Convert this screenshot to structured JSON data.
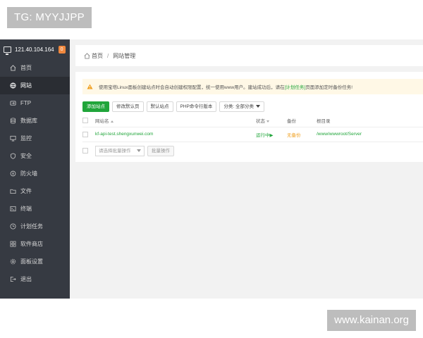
{
  "watermarks": {
    "top": "TG: MYYJJPP",
    "bottom": "www.kainan.org"
  },
  "server": {
    "ip": "121.40.104.164",
    "badge": "0"
  },
  "sidebar": {
    "items": [
      {
        "label": "首页",
        "icon": "home-icon"
      },
      {
        "label": "网站",
        "icon": "globe-icon",
        "active": true
      },
      {
        "label": "FTP",
        "icon": "ftp-icon"
      },
      {
        "label": "数据库",
        "icon": "database-icon"
      },
      {
        "label": "监控",
        "icon": "monitor-icon"
      },
      {
        "label": "安全",
        "icon": "shield-icon"
      },
      {
        "label": "防火墙",
        "icon": "firewall-icon"
      },
      {
        "label": "文件",
        "icon": "folder-icon"
      },
      {
        "label": "终端",
        "icon": "terminal-icon"
      },
      {
        "label": "计划任务",
        "icon": "clock-icon"
      },
      {
        "label": "软件商店",
        "icon": "grid-icon"
      },
      {
        "label": "面板设置",
        "icon": "gear-icon"
      },
      {
        "label": "退出",
        "icon": "logout-icon"
      }
    ]
  },
  "breadcrumb": {
    "home": "首页",
    "separator": "/",
    "current": "网站管理"
  },
  "notice": {
    "text_before": "使用宝塔Linux面板创建站点时会自动创建权限配置，统一使用www用户。建站成功后，请在",
    "link": "[计划任务]",
    "text_after": "页面添加定时备份任务!"
  },
  "toolbar": {
    "add_site": "添加站点",
    "modify_default_page": "修改默认页",
    "default_site": "默认站点",
    "php_cli_version": "PHP命令行版本",
    "category": "分类: 全部分类"
  },
  "table": {
    "headers": {
      "name": "网站名",
      "status": "状态",
      "backup": "备份",
      "root": "根目录"
    },
    "rows": [
      {
        "name": "kf-api-test.shengxunwei.com",
        "status": "运行中▶",
        "backup": "无备份",
        "root": "/www/wwwroot/Server"
      }
    ]
  },
  "batch": {
    "placeholder": "请选择批量操作",
    "button": "批量操作"
  },
  "colors": {
    "sidebar_bg": "#363a42",
    "accent_green": "#20a53a",
    "warning_orange": "#f0a020",
    "badge_orange": "#f0883e"
  }
}
